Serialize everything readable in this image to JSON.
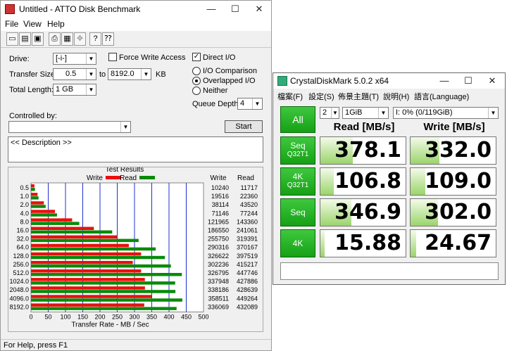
{
  "atto": {
    "title": "Untitled - ATTO Disk Benchmark",
    "window_controls": [
      "—",
      "☐",
      "✕"
    ],
    "menu": [
      "File",
      "View",
      "Help"
    ],
    "toolbar": [
      "new-icon",
      "open-icon",
      "save-icon",
      "print-icon",
      "print-preview-icon",
      "move-icon",
      "about-icon",
      "help-icon"
    ],
    "form": {
      "drive_label": "Drive:",
      "drive_value": "[-i-]",
      "force_write_label": "Force Write Access",
      "direct_io_label": "Direct I/O",
      "transfer_size_label": "Transfer Size:",
      "transfer_from": "0.5",
      "to_label": "to",
      "transfer_to": "8192.0",
      "kb_label": "KB",
      "total_length_label": "Total Length:",
      "total_length_value": "1 GB",
      "io_comparison_label": "I/O Comparison",
      "overlapped_label": "Overlapped I/O",
      "neither_label": "Neither",
      "queue_depth_label": "Queue Depth:",
      "queue_depth_value": "4",
      "controlled_by_label": "Controlled by:",
      "controlled_by_value": "",
      "start_label": "Start",
      "description": "<< Description >>"
    },
    "status": "For Help, press F1"
  },
  "chart_data": {
    "type": "bar",
    "title": "Test Results",
    "xlabel": "Transfer Rate - MB / Sec",
    "legend": [
      {
        "name": "Write",
        "color": "#e8100e"
      },
      {
        "name": "Read",
        "color": "#0a8a0a"
      }
    ],
    "write_header": "Write",
    "read_header": "Read",
    "categories": [
      "0.5",
      "1.0",
      "2.0",
      "4.0",
      "8.0",
      "16.0",
      "32.0",
      "64.0",
      "128.0",
      "256.0",
      "512.0",
      "1024.0",
      "2048.0",
      "4096.0",
      "8192.0"
    ],
    "series": [
      {
        "name": "Write",
        "values": [
          10240,
          19516,
          38114,
          71146,
          121965,
          186550,
          255750,
          290316,
          326622,
          302236,
          326795,
          337948,
          338186,
          358511,
          336069
        ]
      },
      {
        "name": "Read",
        "values": [
          11717,
          22360,
          43520,
          77244,
          143360,
          241061,
          319391,
          370167,
          397519,
          415217,
          447746,
          427886,
          428639,
          449264,
          432089
        ]
      }
    ],
    "xticks": [
      "0",
      "50",
      "100",
      "150",
      "200",
      "250",
      "300",
      "350",
      "400",
      "450",
      "500"
    ],
    "xlim": [
      0,
      500
    ]
  },
  "cdm": {
    "title": "CrystalDiskMark 5.0.2 x64",
    "window_controls": [
      "—",
      "☐",
      "✕"
    ],
    "menu": [
      "檔案(F)",
      "設定(S)",
      "佈景主題(T)",
      "說明(H)",
      "語言(Language)"
    ],
    "all_label": "All",
    "count_value": "2",
    "size_value": "1GiB",
    "drive_value": "I: 0% (0/119GiB)",
    "read_header": "Read [MB/s]",
    "write_header": "Write [MB/s]",
    "rows": [
      {
        "label": "Seq",
        "sub": "Q32T1",
        "read": "378.1",
        "write": "332.0",
        "read_pct": 0.38,
        "write_pct": 0.34
      },
      {
        "label": "4K",
        "sub": "Q32T1",
        "read": "106.8",
        "write": "109.0",
        "read_pct": 0.16,
        "write_pct": 0.17
      },
      {
        "label": "Seq",
        "sub": "",
        "read": "346.9",
        "write": "302.0",
        "read_pct": 0.36,
        "write_pct": 0.32
      },
      {
        "label": "4K",
        "sub": "",
        "read": "15.88",
        "write": "24.67",
        "read_pct": 0.05,
        "write_pct": 0.07
      }
    ],
    "comment": ""
  }
}
